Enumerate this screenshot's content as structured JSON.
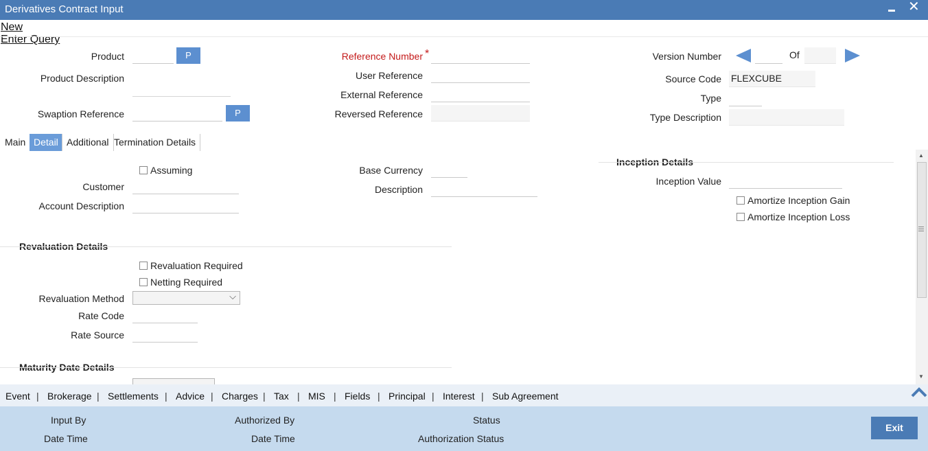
{
  "window": {
    "title": "Derivatives Contract Input"
  },
  "menu": {
    "new": "New",
    "enter_query": "Enter Query"
  },
  "header": {
    "product_label": "Product",
    "product_desc_label": "Product Description",
    "swaption_ref_label": "Swaption Reference",
    "lov_button": "P",
    "reference_number_label": "Reference Number",
    "required_marker": "*",
    "user_reference_label": "User Reference",
    "external_reference_label": "External Reference",
    "reversed_reference_label": "Reversed Reference",
    "version_number_label": "Version Number",
    "of_label": "Of",
    "source_code_label": "Source Code",
    "source_code_value": "FLEXCUBE",
    "type_label": "Type",
    "type_description_label": "Type Description"
  },
  "tabs": [
    {
      "label": "Main",
      "active": false
    },
    {
      "label": "Detail",
      "active": true
    },
    {
      "label": "Additional",
      "active": false
    },
    {
      "label": "Termination Details",
      "active": false
    }
  ],
  "detail": {
    "assuming_label": "Assuming",
    "customer_label": "Customer",
    "account_desc_label": "Account Description",
    "base_currency_label": "Base Currency",
    "description_label": "Description",
    "inception_section": "Inception Details",
    "inception_value_label": "Inception Value",
    "amortize_gain_label": "Amortize Inception Gain",
    "amortize_loss_label": "Amortize Inception Loss",
    "revaluation_section": "Revaluation Details",
    "revaluation_required_label": "Revaluation Required",
    "netting_required_label": "Netting Required",
    "revaluation_method_label": "Revaluation Method",
    "rate_code_label": "Rate Code",
    "rate_source_label": "Rate Source",
    "maturity_section": "Maturity Date Details"
  },
  "bottom_links": [
    "Event",
    "Brokerage",
    "Settlements",
    "Advice",
    "Charges",
    "Tax",
    "MIS",
    "Fields",
    "Principal",
    "Interest",
    "Sub Agreement"
  ],
  "bottom_separator": "|",
  "footer": {
    "input_by": "Input By",
    "date_time_1": "Date Time",
    "authorized_by": "Authorized By",
    "date_time_2": "Date Time",
    "status": "Status",
    "authorization_status": "Authorization Status",
    "exit": "Exit"
  },
  "colors": {
    "titlebar": "#4a7bb5",
    "accent": "#5c8fd0",
    "footer": "#c5daee",
    "required": "#c41a1a"
  },
  "icons": {
    "minimize": "minimize-icon",
    "close": "close-icon",
    "prev": "arrow-left-icon",
    "next": "arrow-right-icon",
    "collapse": "chevron-up-icon",
    "dropdown": "chevron-down-icon"
  }
}
